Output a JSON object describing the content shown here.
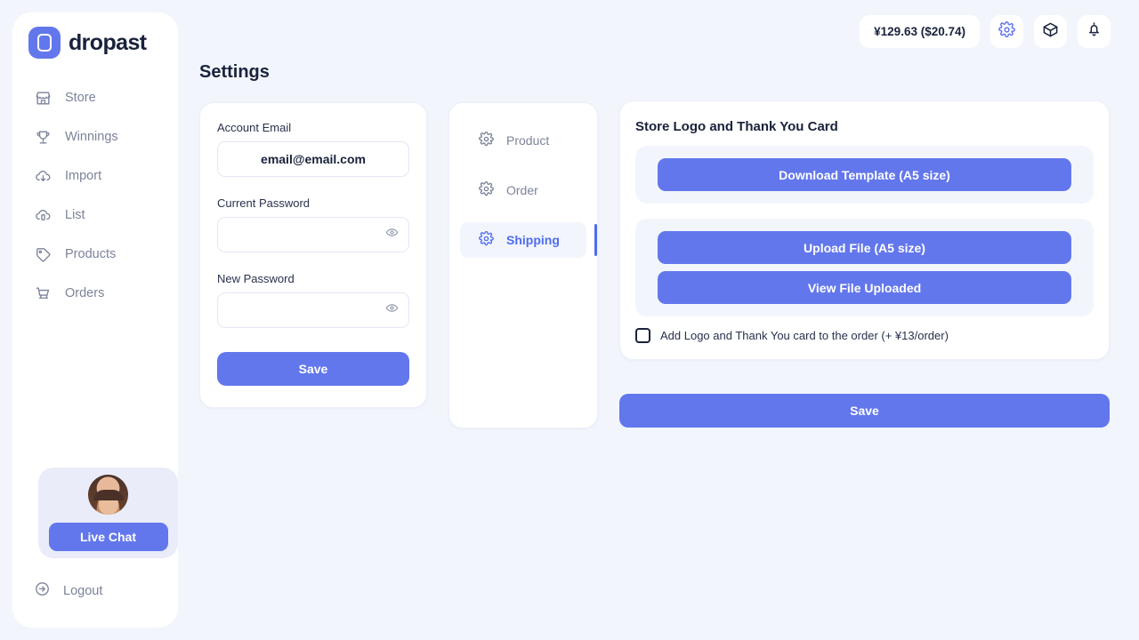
{
  "brand": {
    "name": "dropast",
    "logo_icon": "dropast-logo-icon",
    "accent": "#6377EC"
  },
  "sidebar": {
    "items": [
      {
        "label": "Store",
        "icon": "store-icon"
      },
      {
        "label": "Winnings",
        "icon": "trophy-icon"
      },
      {
        "label": "Import",
        "icon": "cloud-download-icon"
      },
      {
        "label": "List",
        "icon": "cloud-upload-icon"
      },
      {
        "label": "Products",
        "icon": "tag-icon"
      },
      {
        "label": "Orders",
        "icon": "cart-icon"
      }
    ],
    "chat": {
      "button_label": "Live Chat",
      "avatar_icon": "agent-avatar"
    },
    "logout": {
      "label": "Logout",
      "icon": "logout-icon"
    }
  },
  "header": {
    "balance": "¥129.63 ($20.74)",
    "icons": [
      {
        "name": "gear-icon",
        "active": true
      },
      {
        "name": "box-icon",
        "active": false
      },
      {
        "name": "bell-icon",
        "active": false
      }
    ]
  },
  "page": {
    "title": "Settings"
  },
  "account": {
    "email_label": "Account Email",
    "email_value": "email@email.com",
    "email_placeholder": "email@email.com",
    "current_password_label": "Current Password",
    "current_password_value": "",
    "current_password_placeholder": "",
    "new_password_label": "New Password",
    "new_password_value": "",
    "new_password_placeholder": "",
    "save_label": "Save",
    "eye_icon": "eye-icon"
  },
  "settings_nav": {
    "items": [
      {
        "label": "Product",
        "icon": "gear-icon",
        "active": false
      },
      {
        "label": "Order",
        "icon": "gear-icon",
        "active": false
      },
      {
        "label": "Shipping",
        "icon": "gear-icon",
        "active": true
      }
    ]
  },
  "logo_card": {
    "title": "Store Logo and Thank You Card",
    "download_label": "Download Template (A5 size)",
    "upload_label": "Upload File (A5 size)",
    "view_label": "View File Uploaded",
    "checkbox_label": "Add Logo and Thank You card to the order (+ ¥13/order)",
    "checkbox_checked": false
  },
  "footer": {
    "save_label": "Save"
  }
}
